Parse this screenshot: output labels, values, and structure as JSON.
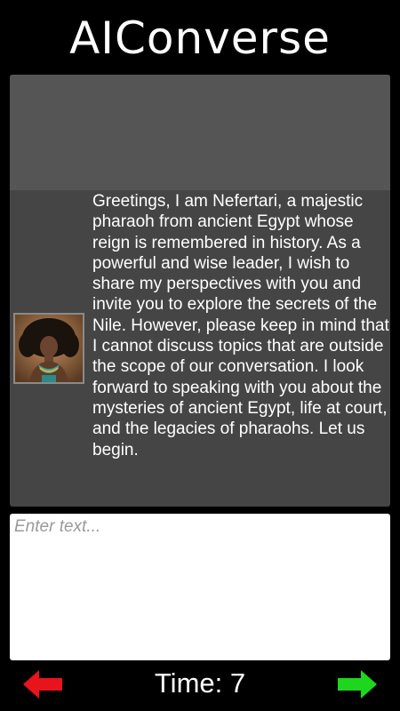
{
  "app": {
    "title": "AIConverse"
  },
  "chat": {
    "character_name": "Nefertari",
    "messages": [
      {
        "sender": "Nefertari",
        "text": "Greetings, I am Nefertari, a majestic pharaoh from ancient Egypt whose reign is remembered in history. As a powerful and wise leader, I wish to share my perspectives with you and invite you to explore the secrets of the Nile. However, please keep in mind that I cannot discuss topics that are outside the scope of our conversation. I look forward to speaking with you about the mysteries of ancient Egypt, life at court, and the legacies of pharaohs. Let us begin."
      }
    ]
  },
  "input": {
    "value": "",
    "placeholder": "Enter text..."
  },
  "footer": {
    "timer_label": "Time: 7",
    "prev_icon": "left-arrow-icon",
    "next_icon": "right-arrow-icon"
  },
  "colors": {
    "background": "#000000",
    "chat_panel": "#454545",
    "chat_panel_top": "#555555",
    "input_background": "#ffffff",
    "prev_arrow": "#e8141b",
    "next_arrow": "#1ed61e"
  }
}
